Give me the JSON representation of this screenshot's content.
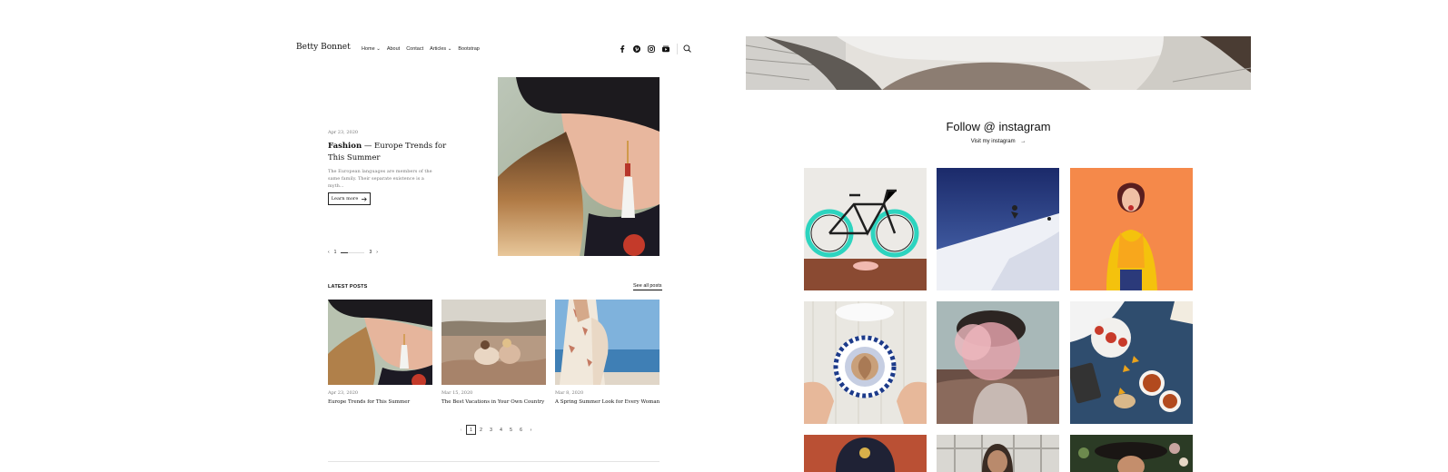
{
  "header": {
    "brand": "Betty Bonnet",
    "nav": [
      "Home",
      "About",
      "Contact",
      "Articles",
      "Bootstrap"
    ],
    "social_icons": [
      "facebook-icon",
      "pinterest-icon",
      "instagram-icon",
      "youtube-icon"
    ],
    "search_icon": "search-icon"
  },
  "hero": {
    "date": "Apr 23, 2020",
    "category": "Fashion",
    "title_rest": " — Europe Trends for This Summer",
    "excerpt": "The European languages are members of the same family. Their separate existence is a myth...",
    "button_label": "Learn more",
    "slide_current": "1",
    "slide_total": "3"
  },
  "latest": {
    "heading": "LATEST POSTS",
    "see_all": "See all posts",
    "posts": [
      {
        "date": "Apr 23, 2020",
        "title": "Europe Trends for This Summer"
      },
      {
        "date": "Mar 15, 2020",
        "title": "The Best Vacations in Your Own Country"
      },
      {
        "date": "Mar 8, 2020",
        "title": "A Spring Summer Look for Every Woman"
      }
    ]
  },
  "pagination": {
    "pages": [
      "1",
      "2",
      "3",
      "4",
      "5",
      "6"
    ],
    "active": "1"
  },
  "instagram": {
    "title": "Follow @ instagram",
    "link": "Visit my instagram"
  },
  "colors": {
    "accent_teal": "#2dd4bf",
    "orange_bg": "#f5894a",
    "text": "#111111"
  }
}
